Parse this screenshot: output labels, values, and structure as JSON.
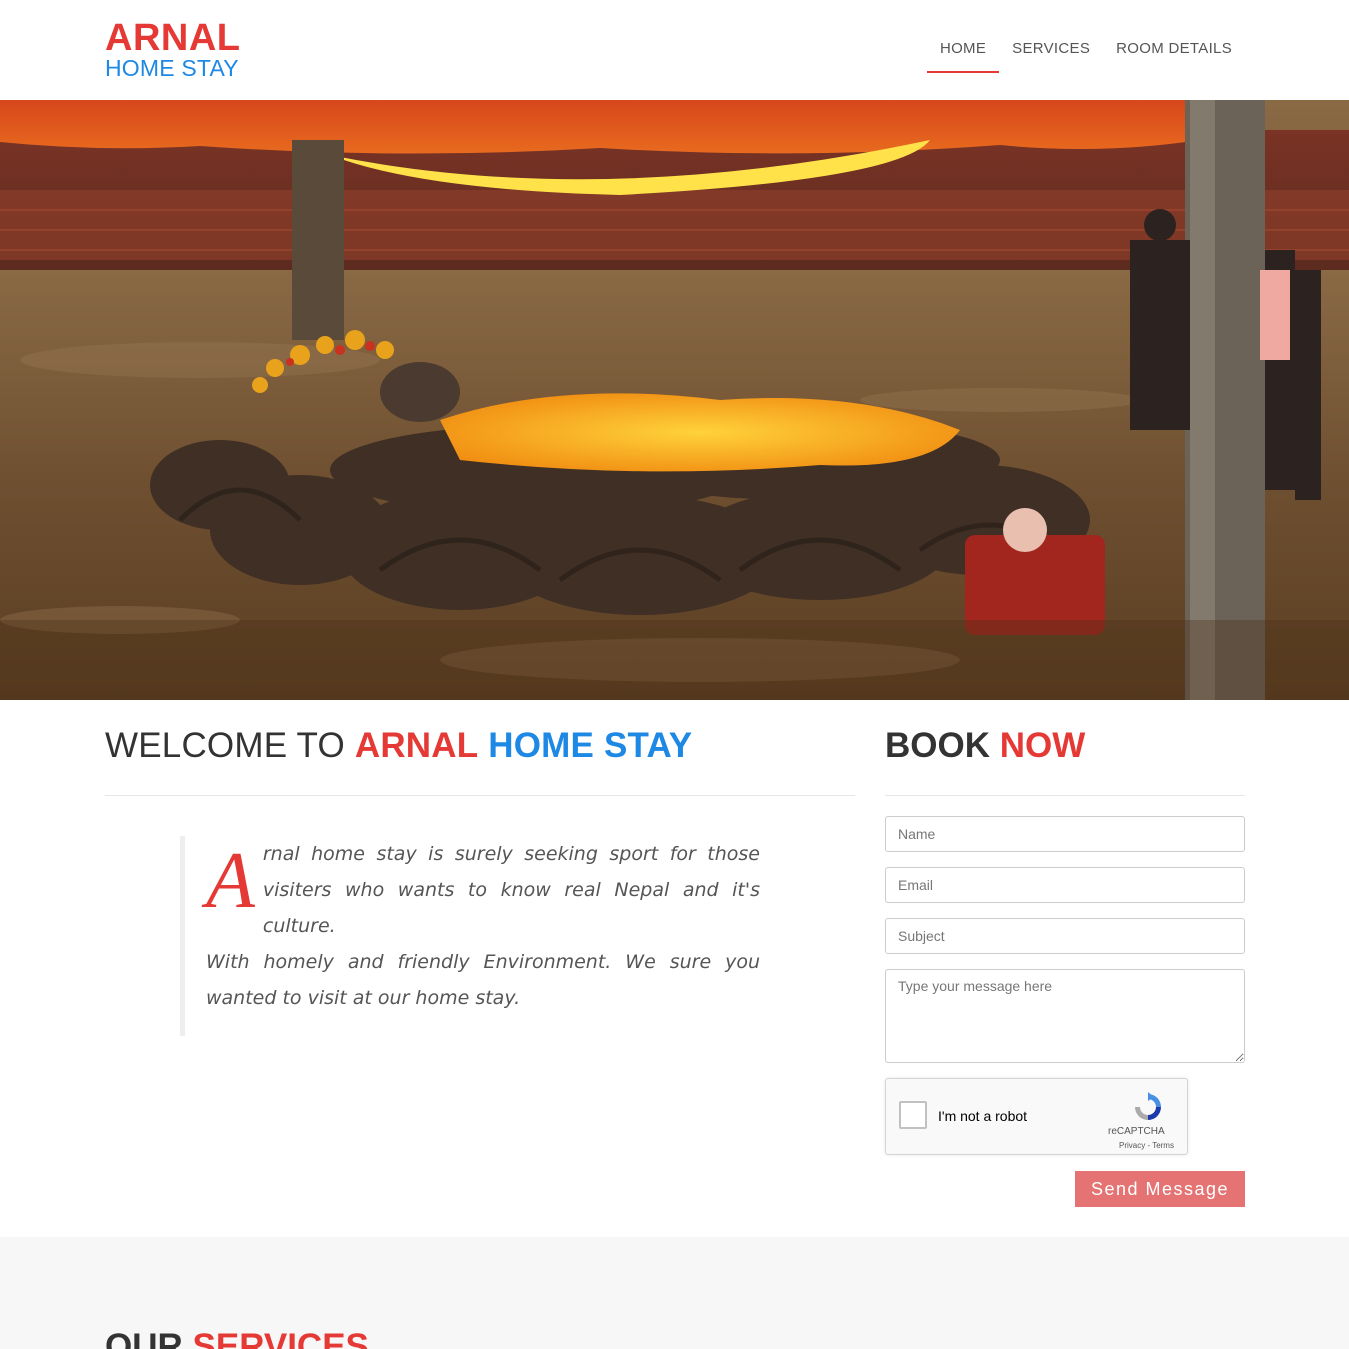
{
  "brand": {
    "name_top": "ARNAL",
    "name_bottom": "HOME STAY"
  },
  "nav": {
    "items": [
      {
        "label": "HOME",
        "active": true
      },
      {
        "label": "SERVICES",
        "active": false
      },
      {
        "label": "ROOM DETAILS",
        "active": false
      }
    ]
  },
  "hero": {
    "icon": "temple-photo"
  },
  "welcome": {
    "title_prefix": "WELCOME TO",
    "title_red": "ARNAL",
    "title_blue": "HOME STAY",
    "dropcap": "A",
    "paragraph_1": "rnal home stay is surely seeking sport for those visiters who wants to know real Nepal and it's culture.",
    "paragraph_2": "With homely and friendly Environment. We sure you wanted to visit at our home stay."
  },
  "booking": {
    "title_prefix": "BOOK",
    "title_red": "NOW",
    "name_placeholder": "Name",
    "email_placeholder": "Email",
    "subject_placeholder": "Subject",
    "message_placeholder": "Type your message here",
    "recaptcha_label": "I'm not a robot",
    "recaptcha_brand": "reCAPTCHA",
    "recaptcha_links": "Privacy - Terms",
    "send_label": "Send Message"
  },
  "services": {
    "title_prefix": "OUR",
    "title_red": "SERVICES"
  },
  "colors": {
    "accent_red": "#e53935",
    "accent_blue": "#1e88e5",
    "button_red": "#e57373"
  }
}
